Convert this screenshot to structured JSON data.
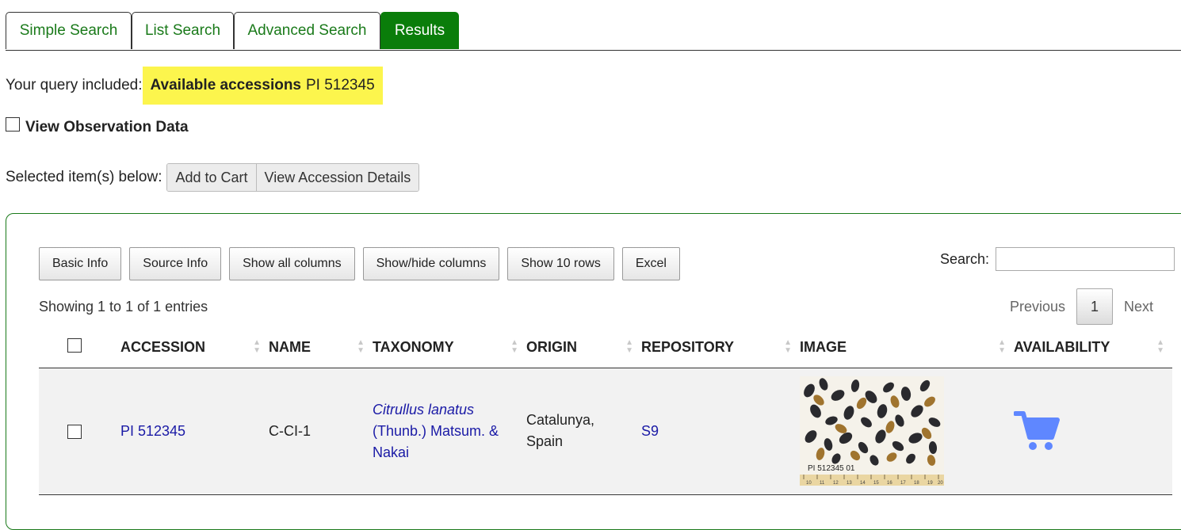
{
  "tabs": [
    {
      "label": "Simple Search"
    },
    {
      "label": "List Search"
    },
    {
      "label": "Advanced Search"
    },
    {
      "label": "Results"
    }
  ],
  "query": {
    "prefix": "Your query included:",
    "filter_label": "Available accessions",
    "filter_value": "PI 512345"
  },
  "observation_toggle": {
    "label": "View Observation Data"
  },
  "selected_actions": {
    "prefix": "Selected item(s) below:",
    "add_to_cart": "Add to Cart",
    "view_details": "View Accession Details"
  },
  "toolbar": {
    "basic_info": "Basic Info",
    "source_info": "Source Info",
    "show_all": "Show all columns",
    "show_hide": "Show/hide columns",
    "show_rows": "Show 10 rows",
    "excel": "Excel"
  },
  "search": {
    "label": "Search:",
    "placeholder": ""
  },
  "summary": "Showing 1 to 1 of 1 entries",
  "pagination": {
    "previous": "Previous",
    "current": "1",
    "next": "Next"
  },
  "columns": [
    "ACCESSION",
    "NAME",
    "TAXONOMY",
    "ORIGIN",
    "REPOSITORY",
    "IMAGE",
    "AVAILABILITY"
  ],
  "rows": [
    {
      "accession": "PI 512345",
      "name": "C-CI-1",
      "taxonomy_species": "Citrullus lanatus",
      "taxonomy_authority": "(Thunb.) Matsum. & Nakai",
      "origin": "Catalunya, Spain",
      "repository": "S9",
      "image_caption": "PI 512345 01"
    }
  ],
  "ruler_ticks": [
    "10",
    "11",
    "12",
    "13",
    "14",
    "15",
    "16",
    "17",
    "18",
    "19",
    "20"
  ],
  "colors": {
    "accent": "#0a7d0a",
    "link": "#1a1aa6",
    "highlight": "#fcf54d",
    "cart": "#5f87ff"
  },
  "icons": {
    "availability": "cart-icon"
  }
}
